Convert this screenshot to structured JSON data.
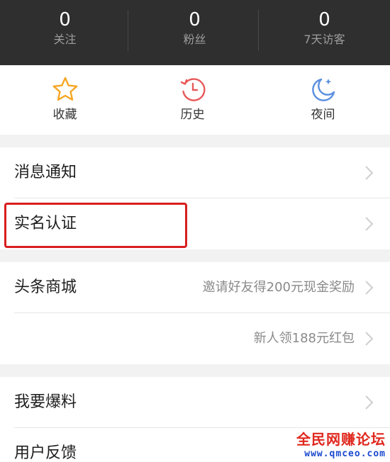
{
  "stats": [
    {
      "value": "0",
      "label": "关注"
    },
    {
      "value": "0",
      "label": "粉丝"
    },
    {
      "value": "0",
      "label": "7天访客"
    }
  ],
  "quick_actions": [
    {
      "label": "收藏",
      "icon": "star-icon"
    },
    {
      "label": "历史",
      "icon": "history-icon"
    },
    {
      "label": "夜间",
      "icon": "night-mode-icon"
    }
  ],
  "menu": {
    "notifications": "消息通知",
    "real_name": "实名认证",
    "mall": "头条商城",
    "mall_promo": "邀请好友得200元现金奖励",
    "red_packet_promo": "新人领188元红包",
    "tip_off": "我要爆料",
    "feedback": "用户反馈"
  },
  "colors": {
    "accent_orange": "#f5a623",
    "accent_red": "#e8595a",
    "accent_blue": "#5b8fe0",
    "highlight_red": "#d81e1e"
  },
  "watermark": {
    "title": "全民网赚论坛",
    "url": "www.qmceo.com"
  }
}
